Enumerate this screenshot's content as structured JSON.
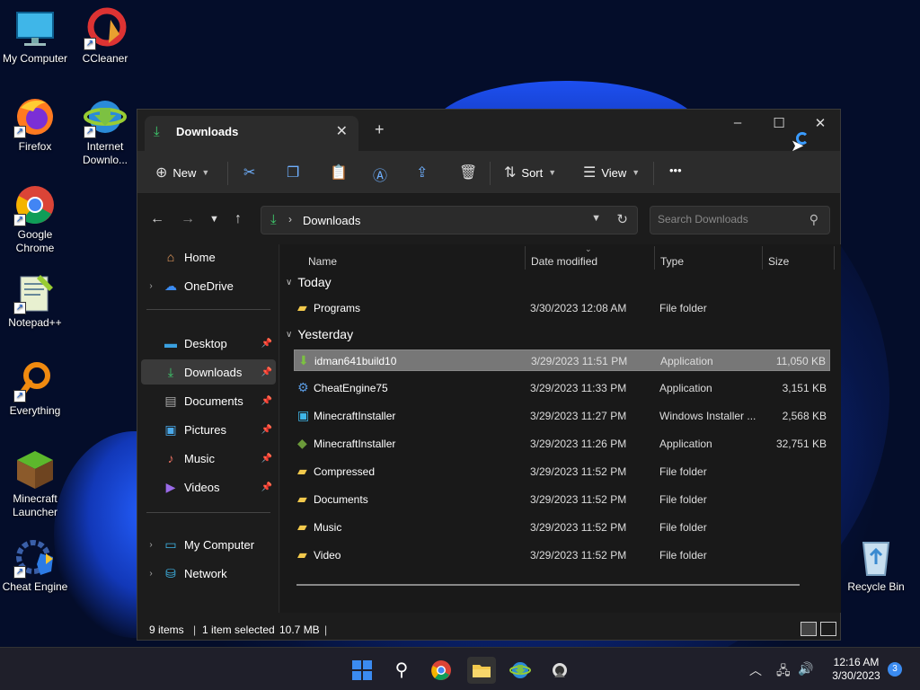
{
  "desktop": {
    "icons": [
      {
        "label": "My Computer",
        "icon": "monitor-icon"
      },
      {
        "label": "CCleaner",
        "icon": "ccleaner-icon"
      },
      {
        "label": "Firefox",
        "icon": "firefox-icon"
      },
      {
        "label": "Internet Downlo...",
        "icon": "idm-icon"
      },
      {
        "label": "Google Chrome",
        "icon": "chrome-icon"
      },
      {
        "label": "Notepad++",
        "icon": "notepadpp-icon"
      },
      {
        "label": "Everything",
        "icon": "everything-icon"
      },
      {
        "label": "Minecraft Launcher",
        "icon": "minecraft-icon"
      },
      {
        "label": "Cheat Engine",
        "icon": "cheat-engine-icon"
      },
      {
        "label": "Recycle Bin",
        "icon": "recycle-bin-icon"
      }
    ]
  },
  "window": {
    "tab_title": "Downloads",
    "new_tab": "+",
    "controls": {
      "minimize": "–",
      "maximize": "☐",
      "close": "✕"
    }
  },
  "toolbar": {
    "new_label": "New",
    "sort_label": "Sort",
    "view_label": "View",
    "more_label": "•••"
  },
  "address": {
    "path": "Downloads",
    "search_placeholder": "Search Downloads"
  },
  "nav": {
    "home": "Home",
    "onedrive": "OneDrive",
    "quick": [
      {
        "label": "Desktop",
        "icon": "desktop-folder-icon"
      },
      {
        "label": "Downloads",
        "icon": "download-icon"
      },
      {
        "label": "Documents",
        "icon": "documents-icon"
      },
      {
        "label": "Pictures",
        "icon": "pictures-icon"
      },
      {
        "label": "Music",
        "icon": "music-icon"
      },
      {
        "label": "Videos",
        "icon": "videos-icon"
      }
    ],
    "my_computer": "My Computer",
    "network": "Network"
  },
  "columns": {
    "name": "Name",
    "date": "Date modified",
    "type": "Type",
    "size": "Size"
  },
  "groups": {
    "today": "Today",
    "yesterday": "Yesterday"
  },
  "rows": [
    {
      "name": "Programs",
      "date": "3/30/2023 12:08 AM",
      "type": "File folder",
      "size": "",
      "icon": "folder-icon"
    },
    {
      "name": "idman641build10",
      "date": "3/29/2023 11:51 PM",
      "type": "Application",
      "size": "11,050 KB",
      "icon": "idm-installer-icon"
    },
    {
      "name": "CheatEngine75",
      "date": "3/29/2023 11:33 PM",
      "type": "Application",
      "size": "3,151 KB",
      "icon": "cheat-engine-installer-icon"
    },
    {
      "name": "MinecraftInstaller",
      "date": "3/29/2023 11:27 PM",
      "type": "Windows Installer ...",
      "size": "2,568 KB",
      "icon": "msi-icon"
    },
    {
      "name": "MinecraftInstaller",
      "date": "3/29/2023 11:26 PM",
      "type": "Application",
      "size": "32,751 KB",
      "icon": "minecraft-installer-icon"
    },
    {
      "name": "Compressed",
      "date": "3/29/2023 11:52 PM",
      "type": "File folder",
      "size": "",
      "icon": "folder-icon"
    },
    {
      "name": "Documents",
      "date": "3/29/2023 11:52 PM",
      "type": "File folder",
      "size": "",
      "icon": "folder-icon"
    },
    {
      "name": "Music",
      "date": "3/29/2023 11:52 PM",
      "type": "File folder",
      "size": "",
      "icon": "folder-icon"
    },
    {
      "name": "Video",
      "date": "3/29/2023 11:52 PM",
      "type": "File folder",
      "size": "",
      "icon": "folder-icon"
    }
  ],
  "status": {
    "items": "9 items",
    "selected": "1 item selected",
    "size": "10.7 MB"
  },
  "taskbar": {
    "time": "12:16 AM",
    "date": "3/30/2023",
    "notifications": "3"
  },
  "colors": {
    "accent": "#3b8bf0",
    "download_green": "#3ecf6e",
    "folder": "#f2c94c",
    "selected_row": "#777777"
  }
}
